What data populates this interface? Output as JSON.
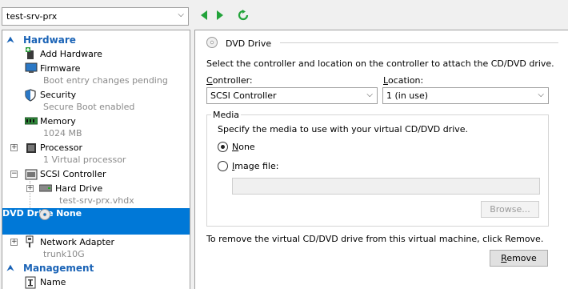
{
  "vm_selector": {
    "value": "test-srv-prx"
  },
  "nav": {
    "back_icon": "back-arrow-icon",
    "forward_icon": "forward-arrow-icon",
    "refresh_icon": "refresh-icon"
  },
  "tree": {
    "hardware_header": "Hardware",
    "add_hardware": "Add Hardware",
    "firmware": {
      "label": "Firmware",
      "sub": "Boot entry changes pending"
    },
    "security": {
      "label": "Security",
      "sub": "Secure Boot enabled"
    },
    "memory": {
      "label": "Memory",
      "sub": "1024 MB"
    },
    "processor": {
      "label": "Processor",
      "sub": "1 Virtual processor"
    },
    "scsi": {
      "label": "SCSI Controller"
    },
    "hard_drive": {
      "label": "Hard Drive",
      "sub": "test-srv-prx.vhdx"
    },
    "dvd_drive": {
      "label": "DVD Drive",
      "sub": "None"
    },
    "network": {
      "label": "Network Adapter",
      "sub": "trunk10G"
    },
    "management_header": "Management",
    "name": {
      "label": "Name"
    }
  },
  "detail": {
    "title": "DVD Drive",
    "intro": "Select the controller and location on the controller to attach the CD/DVD drive.",
    "controller_label": "Controller:",
    "controller_value": "SCSI Controller",
    "location_label": "Location:",
    "location_value": "1 (in use)",
    "media_header": "Media",
    "media_desc": "Specify the media to use with your virtual CD/DVD drive.",
    "none_option": "None",
    "image_option": "Image file:",
    "image_path": "",
    "browse_label": "Browse...",
    "remove_text": "To remove the virtual CD/DVD drive from this virtual machine, click Remove.",
    "remove_label": "Remove",
    "selected_media": "None"
  },
  "colors": {
    "accent": "#0078d7",
    "section_header": "#1a63b6",
    "nav_green": "#22a33a"
  }
}
